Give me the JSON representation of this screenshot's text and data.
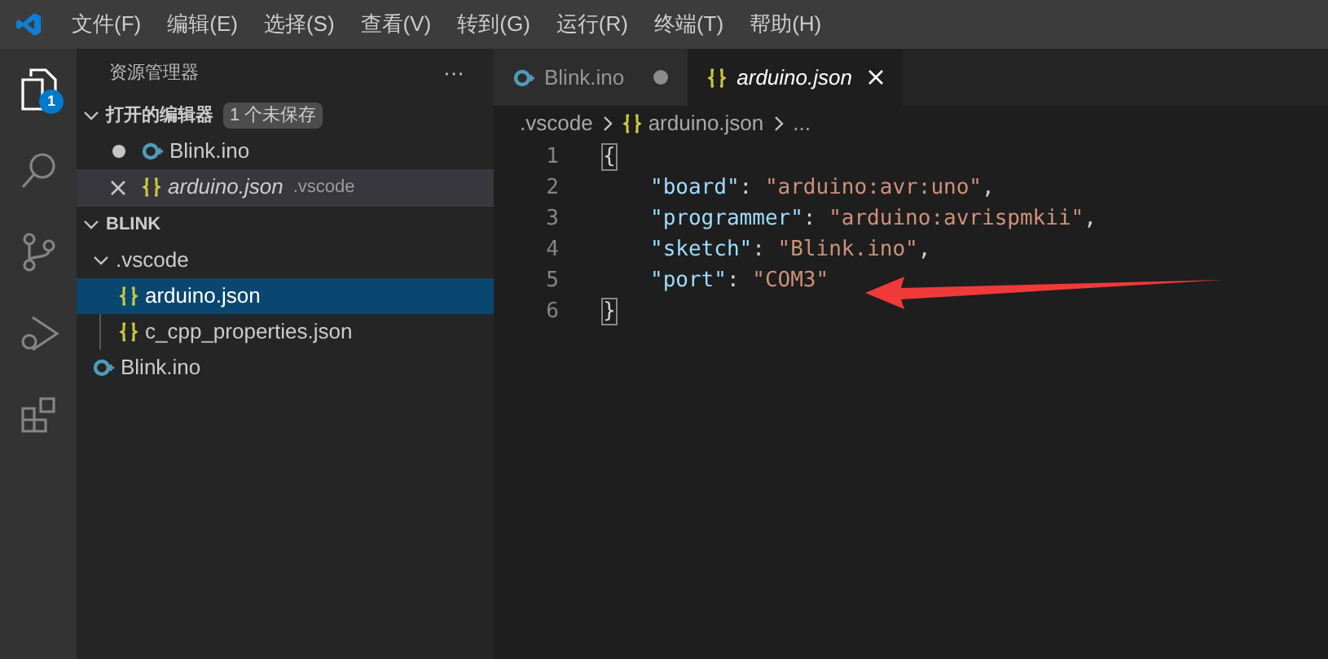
{
  "menu": [
    "文件(F)",
    "编辑(E)",
    "选择(S)",
    "查看(V)",
    "转到(G)",
    "运行(R)",
    "终端(T)",
    "帮助(H)"
  ],
  "activity_bar": [
    {
      "kind": "files",
      "selected": true,
      "badge": "1"
    },
    {
      "kind": "search",
      "selected": false
    },
    {
      "kind": "source-control",
      "selected": false
    },
    {
      "kind": "debug",
      "selected": false
    },
    {
      "kind": "extensions",
      "selected": false
    }
  ],
  "sidebar": {
    "title": "资源管理器",
    "more": "···",
    "open_editors": {
      "label": "打开的编辑器",
      "expanded": true,
      "badge": "1 个未保存",
      "items": [
        {
          "name": "Blink.ino",
          "kind": "ino",
          "modified": true,
          "italic": false,
          "selected": false
        },
        {
          "name": "arduino.json",
          "folder": ".vscode",
          "kind": "json",
          "modified": false,
          "italic": true,
          "selected": true
        }
      ]
    },
    "folder": {
      "label": "BLINK",
      "expanded": true,
      "children": [
        {
          "name": ".vscode",
          "kind": "folder",
          "expanded": true,
          "selected": false,
          "children": [
            {
              "name": "arduino.json",
              "kind": "json",
              "selected": true
            },
            {
              "name": "c_cpp_properties.json",
              "kind": "json",
              "selected": false
            }
          ]
        },
        {
          "name": "Blink.ino",
          "kind": "ino",
          "selected": false
        }
      ]
    }
  },
  "tabs": [
    {
      "label": "Blink.ino",
      "kind": "ino",
      "modified": true,
      "italic": false,
      "selected": false
    },
    {
      "label": "arduino.json",
      "kind": "json",
      "modified": false,
      "italic": true,
      "selected": true
    }
  ],
  "breadcrumb": [
    {
      "label": ".vscode",
      "kind": "folder"
    },
    {
      "label": "arduino.json",
      "kind": "json"
    },
    {
      "label": "...",
      "kind": "symbol"
    }
  ],
  "code": [
    {
      "number": "1",
      "tokens": [
        {
          "kind": "bracket",
          "text": "{"
        }
      ]
    },
    {
      "number": "2",
      "tokens": [
        {
          "kind": "key",
          "text": "\"board\""
        },
        {
          "kind": "punct",
          "text": ": "
        },
        {
          "kind": "string",
          "text": "\"arduino:avr:uno\""
        },
        {
          "kind": "punct",
          "text": ","
        }
      ]
    },
    {
      "number": "3",
      "tokens": [
        {
          "kind": "key",
          "text": "\"programmer\""
        },
        {
          "kind": "punct",
          "text": ": "
        },
        {
          "kind": "string",
          "text": "\"arduino:avrispmkii\""
        },
        {
          "kind": "punct",
          "text": ","
        }
      ]
    },
    {
      "number": "4",
      "tokens": [
        {
          "kind": "key",
          "text": "\"sketch\""
        },
        {
          "kind": "punct",
          "text": ": "
        },
        {
          "kind": "string",
          "text": "\"Blink.ino\""
        },
        {
          "kind": "punct",
          "text": ","
        }
      ]
    },
    {
      "number": "5",
      "tokens": [
        {
          "kind": "key",
          "text": "\"port\""
        },
        {
          "kind": "punct",
          "text": ": "
        },
        {
          "kind": "string",
          "text": "\"COM3\""
        }
      ]
    },
    {
      "number": "6",
      "tokens": [
        {
          "kind": "bracket",
          "text": "}"
        }
      ]
    }
  ]
}
